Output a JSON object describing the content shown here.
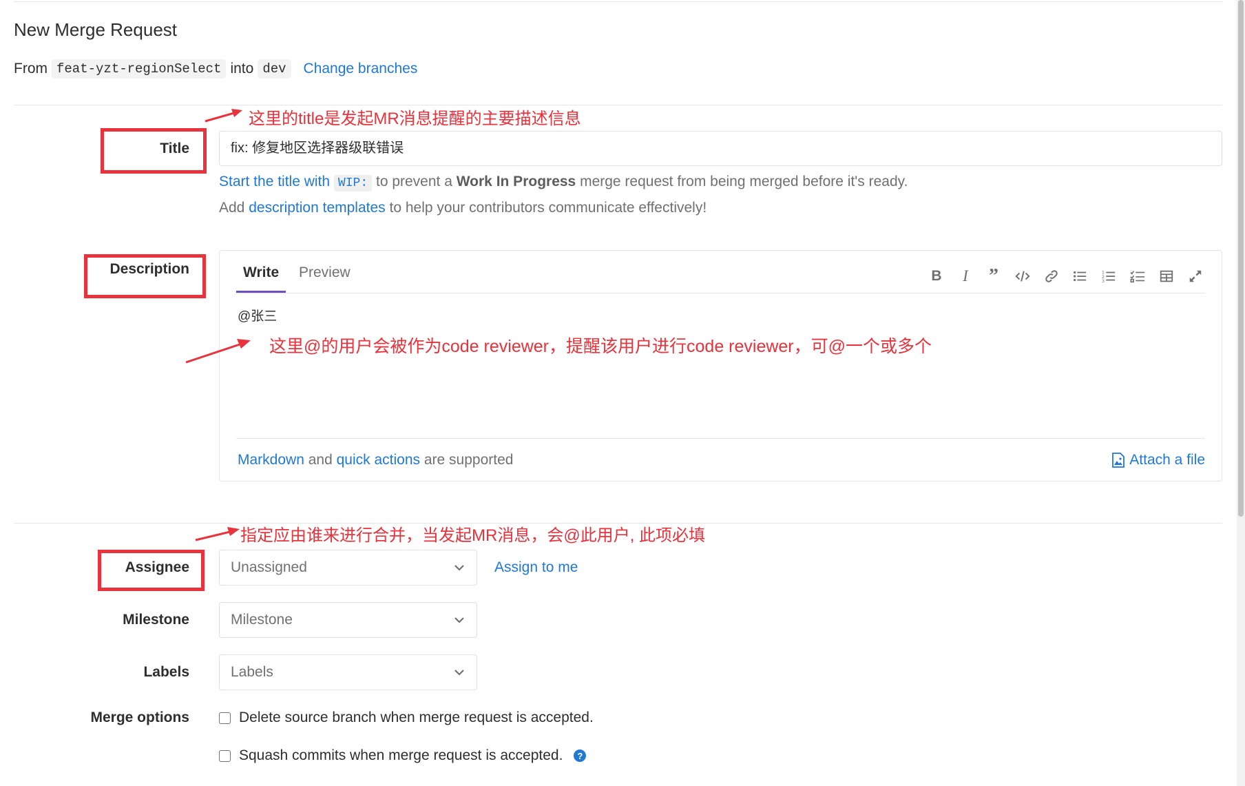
{
  "header": {
    "title": "New Merge Request",
    "from_label": "From",
    "source_branch": "feat-yzt-regionSelect",
    "into_label": "into",
    "target_branch": "dev",
    "change_branches": "Change branches"
  },
  "title_field": {
    "label": "Title",
    "value": "fix: 修复地区选择器级联错误",
    "hint_prefix": "Start the title with",
    "hint_code": "WIP:",
    "hint_middle": "to prevent a",
    "hint_bold": "Work In Progress",
    "hint_suffix": "merge request from being merged before it's ready.",
    "templates_prefix": "Add",
    "templates_link": "description templates",
    "templates_suffix": "to help your contributors communicate effectively!"
  },
  "description": {
    "label": "Description",
    "tab_write": "Write",
    "tab_preview": "Preview",
    "content": "@张三",
    "footer_markdown": "Markdown",
    "footer_and": "and",
    "footer_quick": "quick actions",
    "footer_suffix": "are supported",
    "attach": "Attach a file"
  },
  "toolbar": {
    "icons": [
      "bold-icon",
      "italic-icon",
      "quote-icon",
      "code-icon",
      "link-icon",
      "bullet-list-icon",
      "numbered-list-icon",
      "task-list-icon",
      "table-icon",
      "fullscreen-icon"
    ]
  },
  "assignee": {
    "label": "Assignee",
    "value": "Unassigned",
    "assign_to_me": "Assign to me"
  },
  "milestone": {
    "label": "Milestone",
    "value": "Milestone"
  },
  "labels": {
    "label": "Labels",
    "value": "Labels"
  },
  "merge_options": {
    "label": "Merge options",
    "delete_branch": "Delete source branch when merge request is accepted.",
    "squash": "Squash commits when merge request is accepted."
  },
  "annotations": {
    "title_note": "这里的title是发起MR消息提醒的主要描述信息",
    "description_note": "这里@的用户会被作为code reviewer，提醒该用户进行code reviewer，可@一个或多个",
    "assignee_note": "指定应由谁来进行合并，当发起MR消息，会@此用户, 此项必填"
  },
  "colors": {
    "annotation_red": "#e8323c",
    "link_blue": "#1f78d1",
    "active_tab_underline": "#6b4fbb"
  }
}
